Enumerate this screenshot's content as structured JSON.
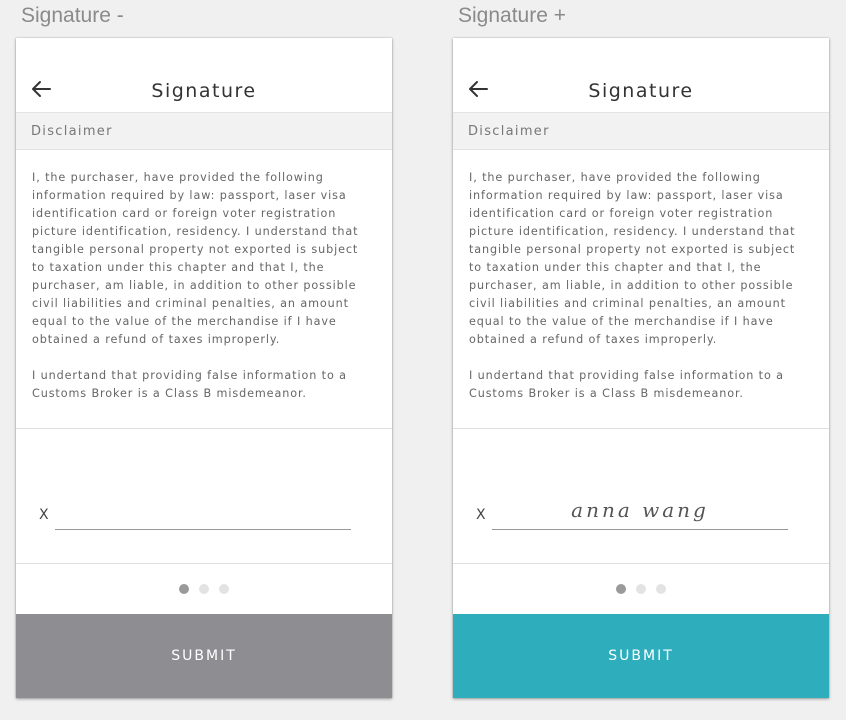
{
  "panels": [
    {
      "caption": "Signature -",
      "title": "Signature",
      "section_label": "Disclaimer",
      "paragraph1": "I, the purchaser, have provided the following information required by law: passport, laser visa identification card or foreign voter registration picture identification, residency. I understand that tangible personal property not exported is subject to taxation under this chapter and that I, the purchaser, am liable, in addition to other possible civil liabilities and criminal penalties, an amount equal to the value of the merchandise if I have obtained a refund of taxes improperly.",
      "paragraph2": "I undertand that providing false information to a Customs Broker is a Class B misdemeanor.",
      "signature_prefix": "X",
      "signature_value": "",
      "pagination": {
        "total": 3,
        "active": 1
      },
      "submit_label": "SUBMIT",
      "submit_color": "#8e8d92"
    },
    {
      "caption": "Signature +",
      "title": "Signature",
      "section_label": "Disclaimer",
      "paragraph1": "I, the purchaser, have provided the following information required by law: passport, laser visa identification card or foreign voter registration picture identification, residency. I understand that tangible personal property not exported is subject to taxation under this chapter and that I, the purchaser, am liable, in addition to other possible civil liabilities and criminal penalties, an amount equal to the value of the merchandise if I have obtained a refund of taxes improperly.",
      "paragraph2": "I undertand that providing false information to a Customs Broker is a Class B misdemeanor.",
      "signature_prefix": "X",
      "signature_value": "anna wang",
      "pagination": {
        "total": 3,
        "active": 1
      },
      "submit_label": "SUBMIT",
      "submit_color": "#2eaebd"
    }
  ],
  "icons": {
    "back": "arrow-left-icon",
    "pagination": "pagination-dot"
  }
}
